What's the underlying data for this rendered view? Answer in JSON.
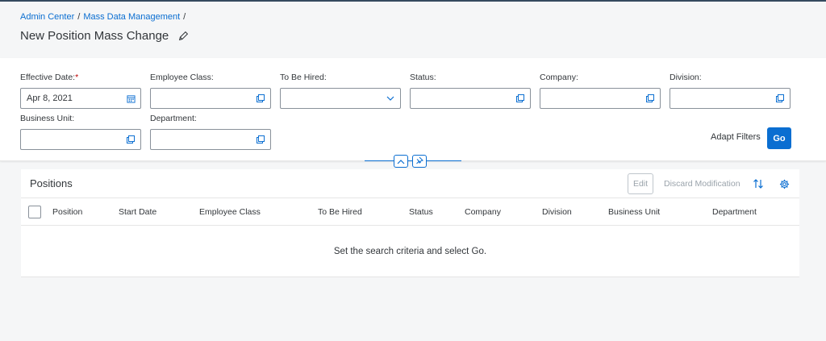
{
  "breadcrumb": [
    {
      "label": "Admin Center"
    },
    {
      "label": "Mass Data Management"
    }
  ],
  "breadcrumb_separator": "/",
  "page_title": "New Position Mass Change",
  "filters": [
    {
      "label": "Effective Date:",
      "required": true,
      "value": "Apr 8, 2021",
      "icon": "calendar-icon"
    },
    {
      "label": "Employee Class:",
      "value": "",
      "icon": "value-help-icon"
    },
    {
      "label": "To Be Hired:",
      "value": "",
      "icon": "chevron-down-icon"
    },
    {
      "label": "Status:",
      "value": "",
      "icon": "value-help-icon"
    },
    {
      "label": "Company:",
      "value": "",
      "icon": "value-help-icon"
    },
    {
      "label": "Division:",
      "value": "",
      "icon": "value-help-icon"
    },
    {
      "label": "Business Unit:",
      "value": "",
      "icon": "value-help-icon"
    },
    {
      "label": "Department:",
      "value": "",
      "icon": "value-help-icon"
    }
  ],
  "required_marker": "*",
  "adapt_filters_label": "Adapt Filters",
  "go_label": "Go",
  "table": {
    "title": "Positions",
    "edit_label": "Edit",
    "discard_label": "Discard Modification",
    "columns": [
      "Position",
      "Start Date",
      "Employee Class",
      "To Be Hired",
      "Status",
      "Company",
      "Division",
      "Business Unit",
      "Department"
    ],
    "no_data_text": "Set the search criteria and select Go."
  },
  "colors": {
    "accent": "#0a6ed1",
    "shell": "#354a5f",
    "required": "#bb0000",
    "background": "#f5f6f7"
  }
}
